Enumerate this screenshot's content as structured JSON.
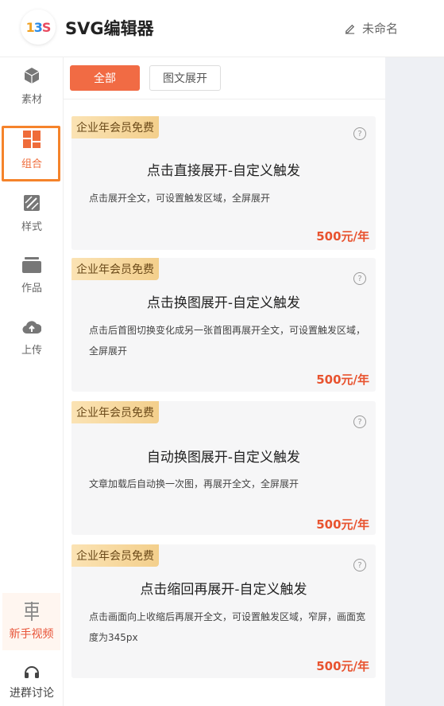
{
  "header": {
    "logo_text": "13S",
    "title": "SVG编辑器",
    "doc_name": "未命名"
  },
  "sidebar": {
    "items": [
      {
        "label": "素材",
        "icon": "cube-icon"
      },
      {
        "label": "组合",
        "icon": "grid-icon",
        "active": true
      },
      {
        "label": "样式",
        "icon": "style-icon"
      },
      {
        "label": "作品",
        "icon": "folder-icon"
      },
      {
        "label": "上传",
        "icon": "cloud-upload-icon"
      }
    ],
    "video_label": "新手视频",
    "group_label": "进群讨论"
  },
  "tabs": [
    {
      "label": "全部",
      "active": true
    },
    {
      "label": "图文展开",
      "active": false
    }
  ],
  "cards": [
    {
      "badge": "企业年会员免费",
      "title": "点击直接展开-自定义触发",
      "desc": "点击展开全文，可设置触发区域，全屏展开",
      "price": "500元/年"
    },
    {
      "badge": "企业年会员免费",
      "title": "点击换图展开-自定义触发",
      "desc": "点击后首图切换变化成另一张首图再展开全文，可设置触发区域，全屏展开",
      "price": "500元/年"
    },
    {
      "badge": "企业年会员免费",
      "title": "自动换图展开-自定义触发",
      "desc": "文章加载后自动换一次图，再展开全文，全屏展开",
      "price": "500元/年"
    },
    {
      "badge": "企业年会员免费",
      "title": "点击缩回再展开-自定义触发",
      "desc": "点击画面向上收缩后再展开全文，可设置触发区域，窄屏，画面宽度为345px",
      "price": "500元/年"
    }
  ],
  "colors": {
    "accent": "#f16b44",
    "price": "#e8532f",
    "highlight_box": "#f5832b",
    "badge_start": "#fbe3b4",
    "badge_end": "#f3cf8c"
  }
}
